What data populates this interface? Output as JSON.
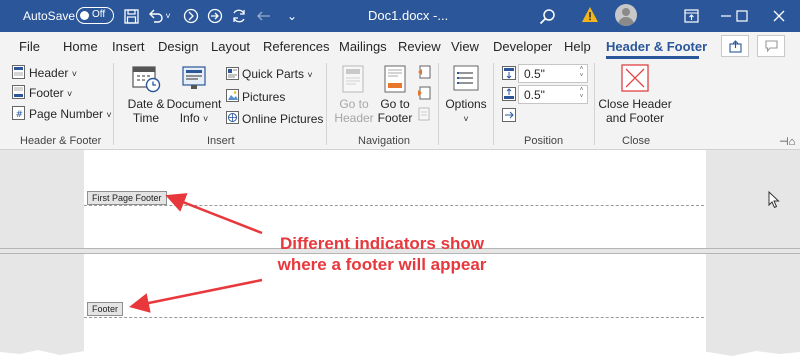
{
  "titlebar": {
    "autosave_label": "AutoSave",
    "autosave_state": "Off",
    "document_title": "Doc1.docx  -...",
    "bg_color": "#2b579a"
  },
  "icons": {
    "save": "save-icon",
    "undo": "undo-icon",
    "redo": "redo-icon",
    "search": "search-icon",
    "warning": "warning-icon",
    "minimize": "minimize-icon",
    "maximize": "maximize-icon",
    "close": "close-icon"
  },
  "tabs": {
    "file": "File",
    "home": "Home",
    "insert": "Insert",
    "design": "Design",
    "layout": "Layout",
    "references": "References",
    "mailings": "Mailings",
    "review": "Review",
    "view": "View",
    "developer": "Developer",
    "help": "Help",
    "header_footer": "Header & Footer"
  },
  "ribbon": {
    "hf_group": {
      "header": "Header",
      "footer": "Footer",
      "page_number": "Page Number",
      "label": "Header & Footer"
    },
    "insert_group": {
      "date_time_1": "Date &",
      "date_time_2": "Time",
      "document_info_1": "Document",
      "document_info_2": "Info",
      "quick_parts": "Quick Parts",
      "pictures": "Pictures",
      "online_pictures": "Online Pictures",
      "label": "Insert"
    },
    "navigation_group": {
      "go_to_header_1": "Go to",
      "go_to_header_2": "Header",
      "go_to_footer_1": "Go to",
      "go_to_footer_2": "Footer",
      "label": "Navigation"
    },
    "options_group": {
      "options": "Options"
    },
    "position_group": {
      "header_from_top": "0.5\"",
      "footer_from_bottom": "0.5\"",
      "label": "Position"
    },
    "close_group": {
      "close_1": "Close Header",
      "close_2": "and Footer",
      "label": "Close"
    }
  },
  "document": {
    "first_page_footer_tag": "First Page Footer",
    "footer_tag": "Footer",
    "annotation_line1": "Different indicators show",
    "annotation_line2": "where a footer will appear",
    "annotation_color": "#e8383c"
  }
}
